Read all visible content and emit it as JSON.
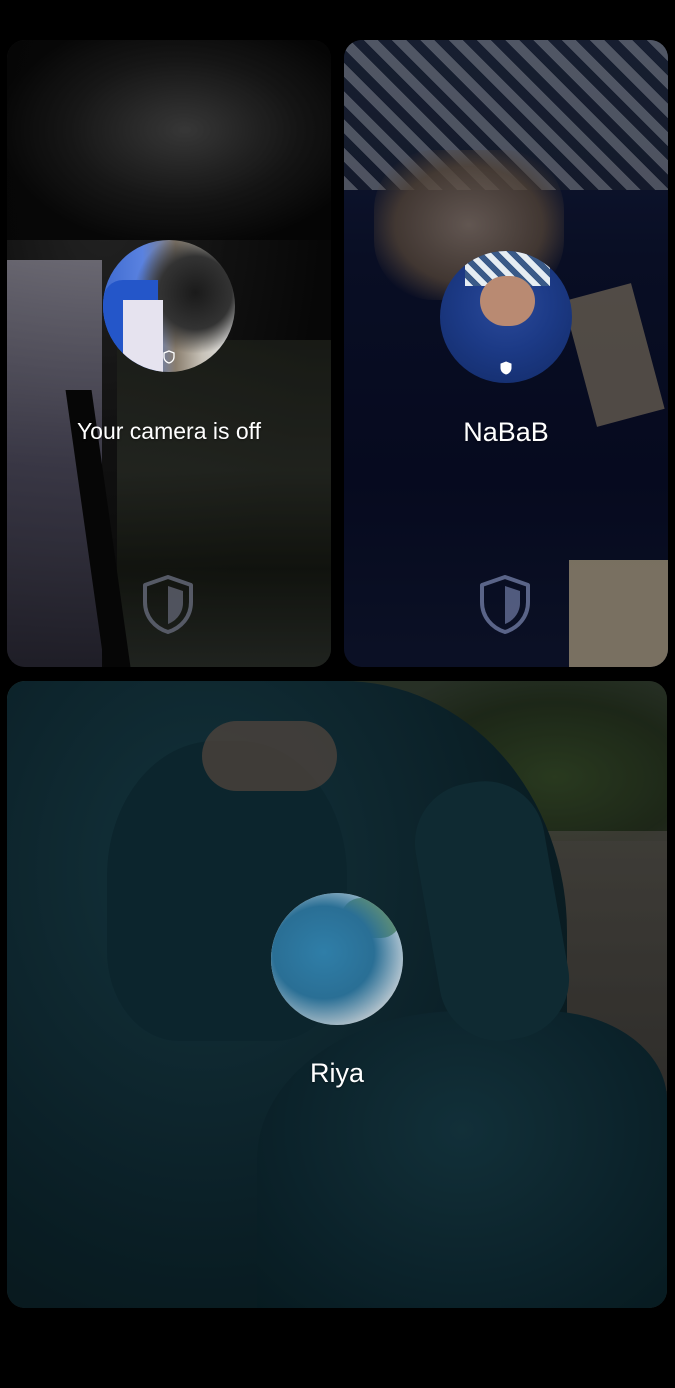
{
  "participants": [
    {
      "id": "self",
      "label": "Your camera is off",
      "avatar_icon": "profile-photo",
      "badge_icon": "shield-icon"
    },
    {
      "id": "nabab",
      "label": "NaBaB",
      "avatar_icon": "profile-photo",
      "badge_icon": "shield-icon"
    },
    {
      "id": "riya",
      "label": "Riya",
      "avatar_icon": "profile-photo"
    }
  ],
  "colors": {
    "background": "#000000",
    "label_text": "#ffffff",
    "shield_stroke": "#7a7f94"
  }
}
